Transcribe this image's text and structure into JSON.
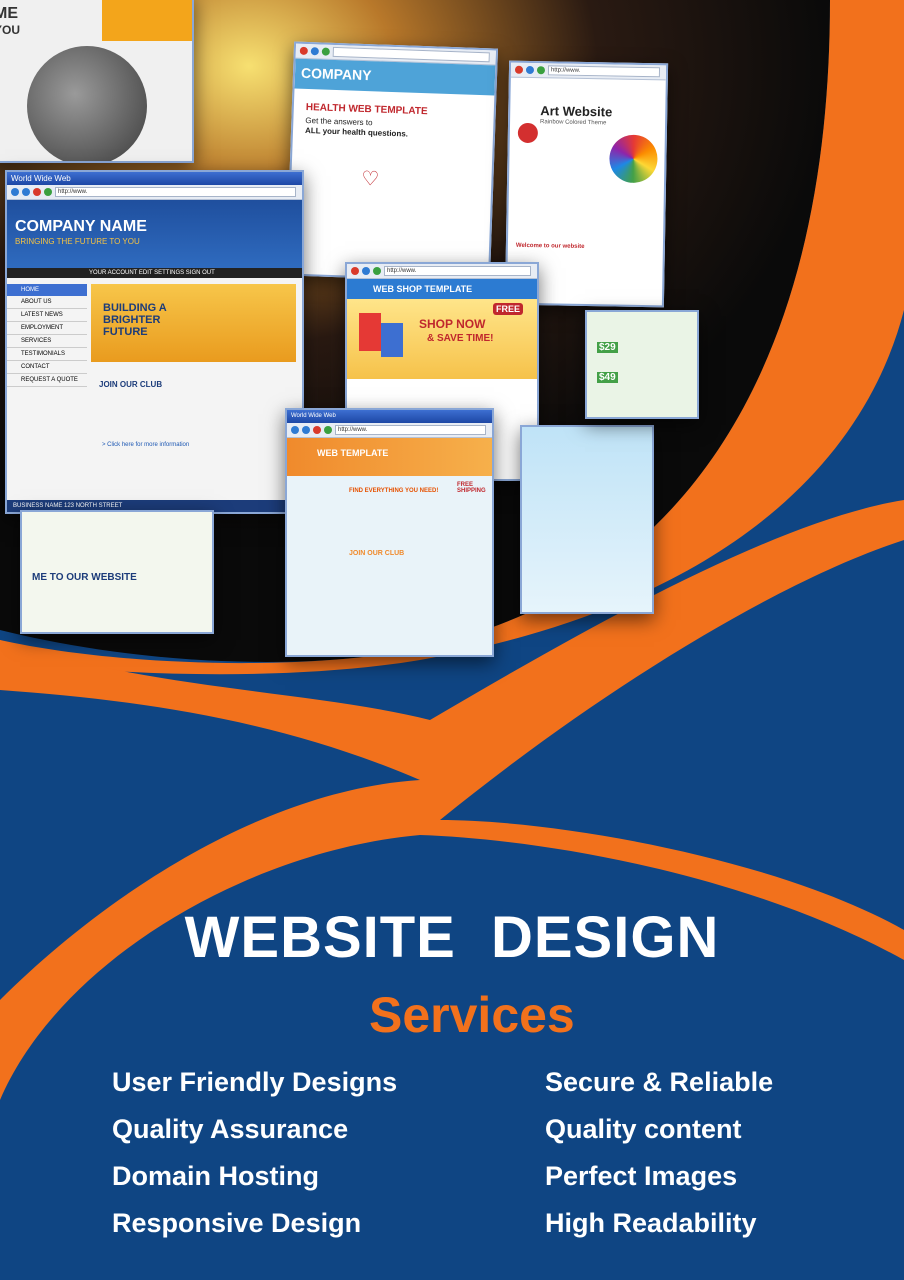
{
  "poster": {
    "title": "WEBSITE  DESIGN",
    "subtitle": "Services",
    "services_left": [
      "User Friendly Designs",
      "Quality Assurance",
      "Domain Hosting",
      "Responsive Design"
    ],
    "services_right": [
      "Secure & Reliable",
      "Quality content",
      "Perfect Images",
      "High Readability"
    ]
  },
  "colors": {
    "navy": "#0f4583",
    "orange": "#f2711c",
    "white": "#ffffff"
  },
  "screens": {
    "top_left": {
      "line1": "ME",
      "line2": "YOU"
    },
    "company": {
      "window": "World Wide Web",
      "url": "http://www.",
      "name": "COMPANY NAME",
      "tagline": "BRINGING THE FUTURE TO YOU",
      "nav": [
        "HOME",
        "ABOUT US",
        "LATEST NEWS",
        "EMPLOYMENT",
        "SERVICES",
        "TESTIMONIALS",
        "CONTACT",
        "REQUEST A QUOTE"
      ],
      "top_links": "YOUR ACCOUNT  EDIT SETTINGS  SIGN OUT",
      "hero": "BUILDING A BRIGHTER FUTURE",
      "club": "JOIN OUR CLUB",
      "more": "> Click here for more information",
      "footer": "BUSINESS NAME  123 NORTH STREET"
    },
    "health": {
      "company": "COMPANY",
      "heading": "HEALTH WEB TEMPLATE",
      "line1": "Get the answers to",
      "line2": "ALL your health questions."
    },
    "art": {
      "url": "http://www.",
      "title": "Art Website",
      "subtitle": "Rainbow Colored Theme",
      "welcome": "Welcome to our website"
    },
    "shop": {
      "url": "http://www.",
      "heading": "WEB SHOP TEMPLATE",
      "line1": "SHOP NOW",
      "line2": "& SAVE TIME!",
      "badge": "FREE"
    },
    "template": {
      "window": "World Wide Web",
      "url": "http://www.",
      "heading": "WEB TEMPLATE",
      "find": "FIND EVERYTHING YOU NEED!",
      "club": "JOIN OUR CLUB",
      "free": "FREE SHIPPING"
    },
    "welcome": {
      "text": "ME TO OUR WEBSITE"
    },
    "price": {
      "p1": "$29",
      "p2": "$49"
    }
  }
}
